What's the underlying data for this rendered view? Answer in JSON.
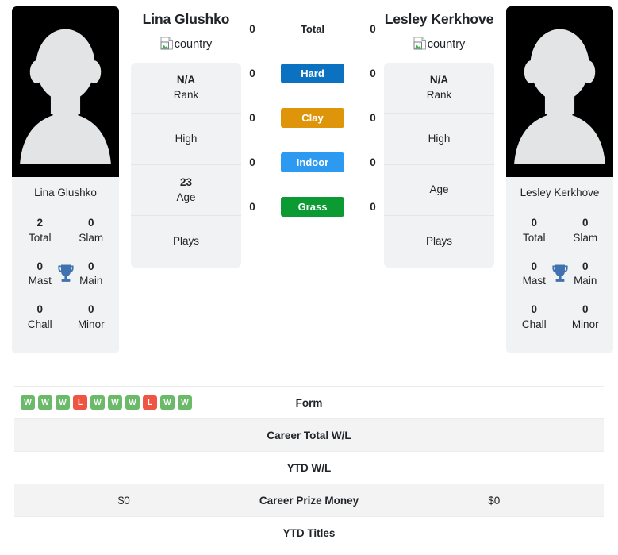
{
  "players": {
    "left": {
      "name": "Lina Glushko",
      "photo_caption": "Lina Glushko",
      "country_alt": "country",
      "titles": {
        "total_value": "2",
        "total_label": "Total",
        "slam_value": "0",
        "slam_label": "Slam",
        "mast_value": "0",
        "mast_label": "Mast",
        "main_value": "0",
        "main_label": "Main",
        "chall_value": "0",
        "chall_label": "Chall",
        "minor_value": "0",
        "minor_label": "Minor"
      },
      "info": [
        {
          "value": "N/A",
          "label": "Rank"
        },
        {
          "value": "",
          "label": "High"
        },
        {
          "value": "23",
          "label": "Age"
        },
        {
          "value": "",
          "label": "Plays"
        }
      ]
    },
    "right": {
      "name": "Lesley Kerkhove",
      "photo_caption": "Lesley Kerkhove",
      "country_alt": "country",
      "titles": {
        "total_value": "0",
        "total_label": "Total",
        "slam_value": "0",
        "slam_label": "Slam",
        "mast_value": "0",
        "mast_label": "Mast",
        "main_value": "0",
        "main_label": "Main",
        "chall_value": "0",
        "chall_label": "Chall",
        "minor_value": "0",
        "minor_label": "Minor"
      },
      "info": [
        {
          "value": "N/A",
          "label": "Rank"
        },
        {
          "value": "",
          "label": "High"
        },
        {
          "value": "",
          "label": "Age"
        },
        {
          "value": "",
          "label": "Plays"
        }
      ]
    }
  },
  "surfaces": [
    {
      "label": "Total",
      "left": "0",
      "right": "0",
      "color": "transparent",
      "plain": true
    },
    {
      "label": "Hard",
      "left": "0",
      "right": "0",
      "color": "#0b71c1",
      "plain": false
    },
    {
      "label": "Clay",
      "left": "0",
      "right": "0",
      "color": "#df9509",
      "plain": false
    },
    {
      "label": "Indoor",
      "left": "0",
      "right": "0",
      "color": "#2b9af0",
      "plain": false
    },
    {
      "label": "Grass",
      "left": "0",
      "right": "0",
      "color": "#0c9b33",
      "plain": false
    }
  ],
  "comparison_rows": [
    {
      "label": "Form",
      "left_form": [
        "W",
        "W",
        "W",
        "L",
        "W",
        "W",
        "W",
        "L",
        "W",
        "W"
      ],
      "left": "",
      "right": "",
      "striped": false
    },
    {
      "label": "Career Total W/L",
      "left": "",
      "right": "",
      "striped": true
    },
    {
      "label": "YTD W/L",
      "left": "",
      "right": "",
      "striped": false
    },
    {
      "label": "Career Prize Money",
      "left": "$0",
      "right": "$0",
      "striped": true
    },
    {
      "label": "YTD Titles",
      "left": "",
      "right": "",
      "striped": false
    }
  ],
  "colors": {
    "form_win": "#6aba6a",
    "form_loss": "#ee5542",
    "trophy": "#4072b0",
    "card_bg": "#f1f2f3",
    "stripe_bg": "#f3f3f3"
  }
}
